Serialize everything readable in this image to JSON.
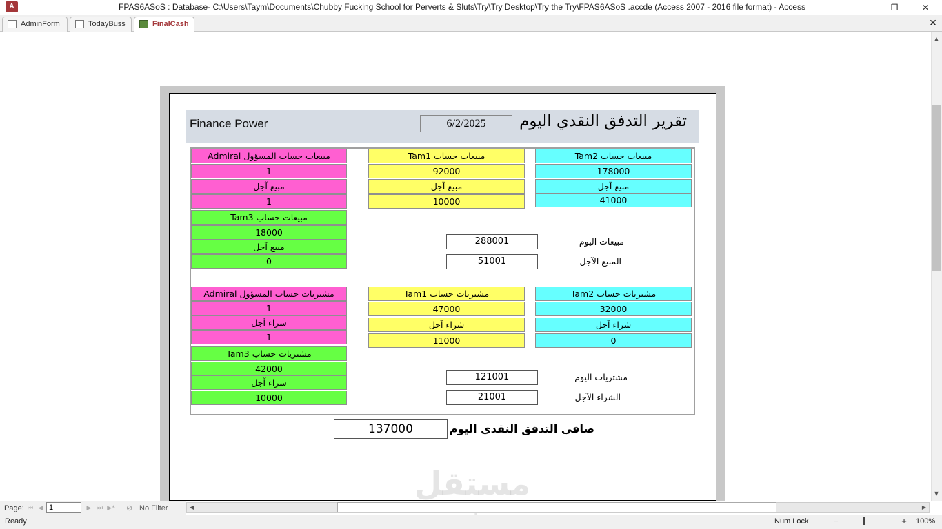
{
  "app": {
    "icon_letter": "A",
    "title": "FPAS6ASoS  : Database- C:\\Users\\Taym\\Documents\\Chubby Fucking School for Perverts & Sluts\\Try\\Try Desktop\\Try the Try\\FPAS6ASoS .accde (Access 2007 - 2016 file format) - Access",
    "minimize": "—",
    "restore": "❐",
    "close": "✕"
  },
  "tabs": [
    {
      "label": "AdminForm",
      "active": false
    },
    {
      "label": "TodayBuss",
      "active": false
    },
    {
      "label": "FinalCash",
      "active": true
    }
  ],
  "doc_close": "✕",
  "report": {
    "company": "Finance Power",
    "date": "6/2/2025",
    "title": "تقرير التدفق النقدي اليوم",
    "sales": {
      "admiral": {
        "header": "مبيعات حساب المسؤول Admiral",
        "value": "1",
        "credit_label": "مبيع آجل",
        "credit_value": "1"
      },
      "tam1": {
        "header": "مبيعات حساب Tam1",
        "value": "92000",
        "credit_label": "مبيع آجل",
        "credit_value": "10000"
      },
      "tam2": {
        "header": "مبيعات حساب Tam2",
        "value": "178000",
        "credit_label": "مبيع آجل",
        "credit_value": "41000"
      },
      "tam3": {
        "header": "مبيعات حساب Tam3",
        "value": "18000",
        "credit_label": "مبيع آجل",
        "credit_value": "0"
      },
      "today_label": "مبيعات اليوم",
      "today_value": "288001",
      "credit_total_label": "المبيع الآجل",
      "credit_total_value": "51001"
    },
    "purchases": {
      "admiral": {
        "header": "مشتريات حساب المسؤول Admiral",
        "value": "1",
        "credit_label": "شراء آجل",
        "credit_value": "1"
      },
      "tam1": {
        "header": "مشتريات حساب Tam1",
        "value": "47000",
        "credit_label": "شراء آجل",
        "credit_value": "11000"
      },
      "tam2": {
        "header": "مشتريات حساب Tam2",
        "value": "32000",
        "credit_label": "شراء آجل",
        "credit_value": "0"
      },
      "tam3": {
        "header": "مشتريات حساب Tam3",
        "value": "42000",
        "credit_label": "شراء آجل",
        "credit_value": "10000"
      },
      "today_label": "مشتريات اليوم",
      "today_value": "121001",
      "credit_total_label": "الشراء الآجل",
      "credit_total_value": "21001"
    },
    "net_label": "صافي التدفق النقدي اليوم",
    "net_value": "137000"
  },
  "nav": {
    "page_label": "Page:",
    "page_value": "1",
    "filter_label": "No Filter"
  },
  "status": {
    "ready": "Ready",
    "num_lock": "Num Lock",
    "zoom": "100%",
    "zoom_minus": "−",
    "zoom_plus": "+"
  },
  "watermark": {
    "text": "مستقل",
    "sub": "mostaql.com"
  },
  "colors": {
    "admiral": "#ff5fd1",
    "tam1": "#ffff66",
    "tam2": "#66ffff",
    "tam3": "#66ff44",
    "header_band": "#d6dce4"
  }
}
